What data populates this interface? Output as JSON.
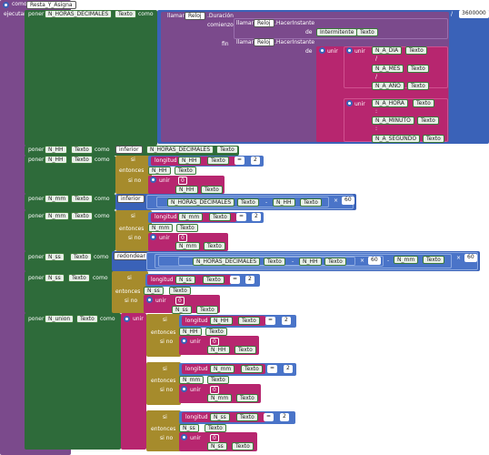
{
  "proc": {
    "como": "como",
    "name": "Resta_Y_Asigna",
    "ejecutar": "ejecutar"
  },
  "common": {
    "poner": "poner",
    "texto": "Texto",
    "como": "como",
    "llamar": "llamar",
    "reloj": "Reloj",
    "si": "si",
    "entonces": "entonces",
    "sino": "si no",
    "unir": "unir",
    "longitud": "longitud",
    "de": "de",
    "eq": "=",
    "div": "/",
    "minus": "-",
    "x": "×"
  },
  "b1": {
    "var": "N_HORAS_DECIMALES",
    "duracion": ".Duración",
    "comienzo": "comienzo",
    "fin": "fin",
    "hacer_instante": ".HacerInstante",
    "intermitente": "Intermitente",
    "div_value": "3600000",
    "sep_slash": "/",
    "sep_colon": ":",
    "sep_space": " ",
    "dia": "N_A_DIA",
    "mes": "N_A_MES",
    "ano": "N_A_AÑO",
    "hora": "N_A_HORA",
    "minuto": "N_A_MINUTO",
    "segundo": "N_A_SEGUNDO"
  },
  "b2": {
    "var": "N_HH",
    "func": "inferior",
    "arg": "N_HORAS_DECIMALES"
  },
  "b3": {
    "var": "N_HH",
    "len_var": "N_HH",
    "len_val": "2",
    "then_var": "N_HH",
    "zero": "0",
    "else_var": "N_HH"
  },
  "b4": {
    "var": "N_mm",
    "func": "inferior",
    "a": "N_HORAS_DECIMALES",
    "b": "N_HH",
    "mul": "60"
  },
  "b5": {
    "var": "N_mm",
    "len_var": "N_mm",
    "len_val": "2",
    "then_var": "N_mm",
    "zero": "0",
    "else_var": "N_mm"
  },
  "b6": {
    "var": "N_ss",
    "func": "redondear",
    "a": "N_HORAS_DECIMALES",
    "b": "N_HH",
    "mul1": "60",
    "c": "N_mm",
    "mul2": "60"
  },
  "b7": {
    "var": "N_ss",
    "len_var": "N_ss",
    "len_val": "2",
    "then_var": "N_ss",
    "zero": "0",
    "else_var": "N_ss"
  },
  "b8": {
    "var": "N_union",
    "hh": {
      "len_var": "N_HH",
      "len_val": "2",
      "then_var": "N_HH",
      "zero": "0",
      "else_var": "N_HH"
    },
    "mm": {
      "len_var": "N_mm",
      "len_val": "2",
      "then_var": "N_mm",
      "zero": "0",
      "else_var": "N_mm"
    },
    "ss": {
      "len_var": "N_ss",
      "len_val": "2",
      "then_var": "N_ss",
      "zero": "0",
      "else_var": "N_ss"
    }
  }
}
